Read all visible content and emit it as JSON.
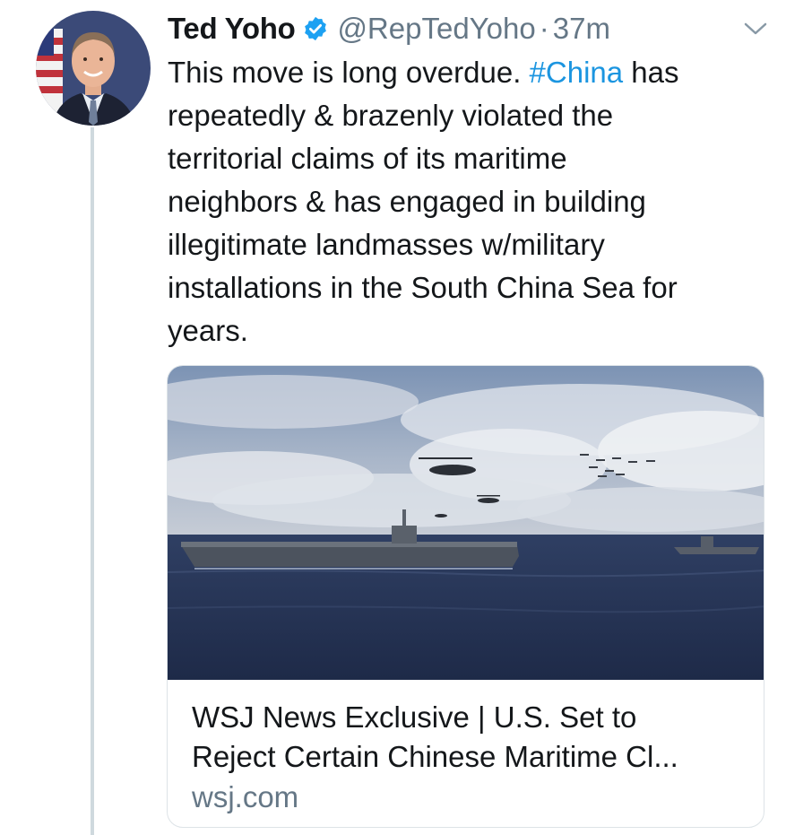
{
  "tweet": {
    "display_name": "Ted Yoho",
    "handle": "@RepTedYoho",
    "separator": "·",
    "time": "37m",
    "text_lines": [
      {
        "before": "This move is long overdue. ",
        "hashtag": "#China",
        "after": " has"
      },
      "repeatedly & brazenly violated the",
      "territorial claims of its maritime",
      "neighbors & has engaged in building",
      "illegitimate landmasses w/military",
      "installations in the South China Sea for",
      "years."
    ]
  },
  "card": {
    "title_lines": [
      "WSJ News Exclusive | U.S. Set to",
      "Reject Certain Chinese Maritime Cl..."
    ],
    "domain": "wsj.com"
  },
  "icons": {
    "verified": "verified-badge-icon",
    "caret": "chevron-down-icon"
  },
  "colors": {
    "text": "#14171a",
    "secondary": "#657786",
    "link": "#1b95e0",
    "verified": "#1da1f2",
    "thread_line": "#cfd9de",
    "card_border": "#dde3e7"
  }
}
